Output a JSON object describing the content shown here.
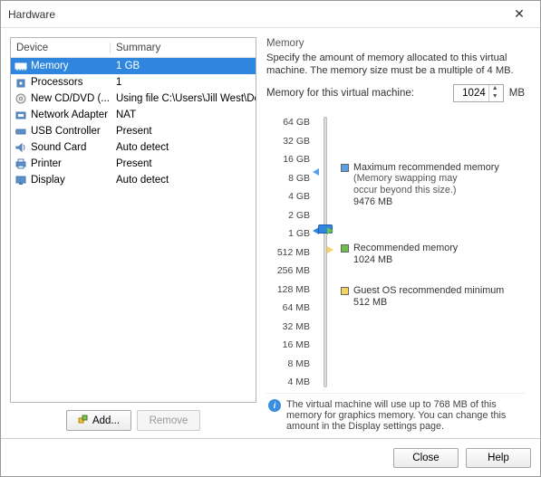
{
  "title": "Hardware",
  "list": {
    "header_device": "Device",
    "header_summary": "Summary",
    "rows": [
      {
        "name": "Memory",
        "summary": "1 GB",
        "icon": "memory",
        "selected": true
      },
      {
        "name": "Processors",
        "summary": "1",
        "icon": "cpu"
      },
      {
        "name": "New CD/DVD (...",
        "summary": "Using file C:\\Users\\Jill West\\Downl...",
        "icon": "disc"
      },
      {
        "name": "Network Adapter",
        "summary": "NAT",
        "icon": "nic"
      },
      {
        "name": "USB Controller",
        "summary": "Present",
        "icon": "usb"
      },
      {
        "name": "Sound Card",
        "summary": "Auto detect",
        "icon": "sound"
      },
      {
        "name": "Printer",
        "summary": "Present",
        "icon": "printer"
      },
      {
        "name": "Display",
        "summary": "Auto detect",
        "icon": "display"
      }
    ]
  },
  "buttons": {
    "add": "Add...",
    "remove": "Remove",
    "close": "Close",
    "help": "Help"
  },
  "memory": {
    "group": "Memory",
    "desc": "Specify the amount of memory allocated to this virtual machine. The memory size must be a multiple of 4 MB.",
    "field_label": "Memory for this virtual machine:",
    "value": "1024",
    "unit": "MB",
    "ticks": [
      "64 GB",
      "32 GB",
      "16 GB",
      "8 GB",
      "4 GB",
      "2 GB",
      "1 GB",
      "512 MB",
      "256 MB",
      "128 MB",
      "64 MB",
      "32 MB",
      "16 MB",
      "8 MB",
      "4 MB"
    ],
    "legend": {
      "max": {
        "label": "Maximum recommended memory",
        "sub1": "(Memory swapping may",
        "sub2": "occur beyond this size.)",
        "val": "9476 MB",
        "color": "#5aa0e6"
      },
      "rec": {
        "label": "Recommended memory",
        "val": "1024 MB",
        "color": "#6fbf4b"
      },
      "min": {
        "label": "Guest OS recommended minimum",
        "val": "512 MB",
        "color": "#f4d35e"
      }
    },
    "info": "The virtual machine will use up to 768 MB of this memory for graphics memory. You can change this amount in the Display settings page."
  }
}
